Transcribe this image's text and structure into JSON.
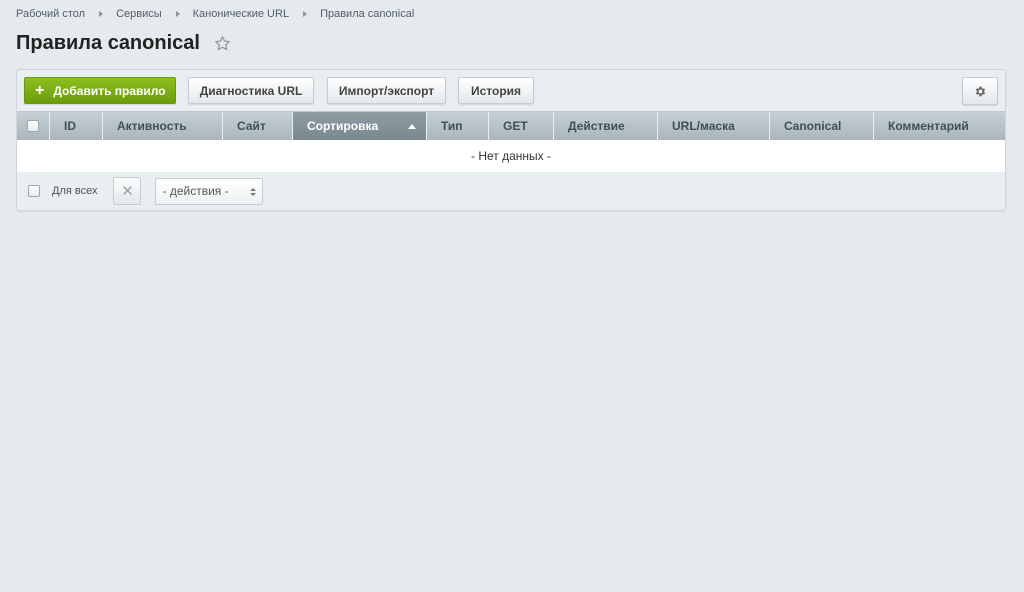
{
  "breadcrumb": {
    "items": [
      "Рабочий стол",
      "Сервисы",
      "Канонические URL",
      "Правила canonical"
    ]
  },
  "page": {
    "title": "Правила canonical"
  },
  "toolbar": {
    "add_label": "Добавить правило",
    "diagnostics_label": "Диагностика URL",
    "import_export_label": "Импорт/экспорт",
    "history_label": "История",
    "settings_icon": "gear-icon"
  },
  "table": {
    "columns": [
      "ID",
      "Активность",
      "Сайт",
      "Сортировка",
      "Тип",
      "GET",
      "Действие",
      "URL/маска",
      "Canonical",
      "Комментарий"
    ],
    "sorted_column": "Сортировка",
    "empty_text": "- Нет данных -"
  },
  "footer": {
    "all_label": "Для всех",
    "actions_select": "- действия -"
  },
  "colors": {
    "add_button": "#7aad14",
    "header": "#b8c3c9",
    "sorted_header": "#84929a",
    "background": "#e4eaed"
  }
}
